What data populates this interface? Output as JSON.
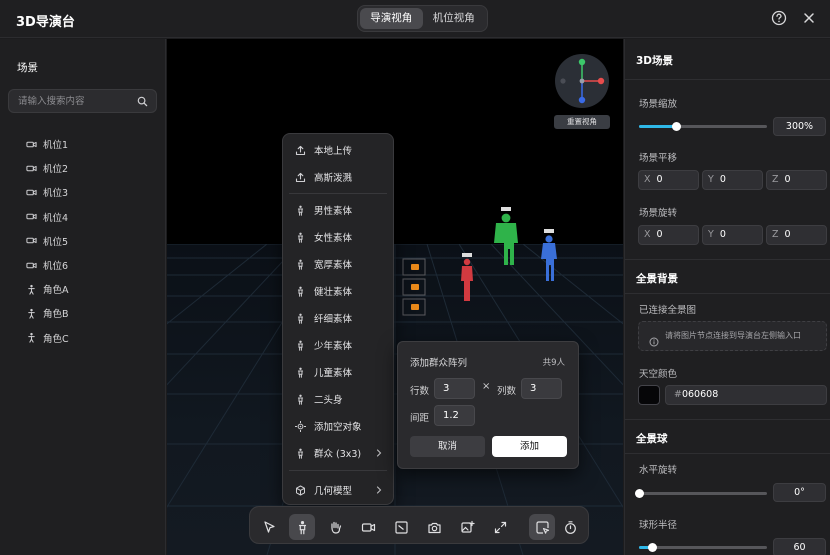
{
  "app": {
    "title": "3D导演台"
  },
  "view_toggle": {
    "director": "导演视角",
    "camera": "机位视角",
    "active": "director"
  },
  "left_panel": {
    "title": "场景",
    "search_placeholder": "请输入搜索内容",
    "items": [
      {
        "label": "机位1",
        "icon": "camera-icon"
      },
      {
        "label": "机位2",
        "icon": "camera-icon"
      },
      {
        "label": "机位3",
        "icon": "camera-icon"
      },
      {
        "label": "机位4",
        "icon": "camera-icon"
      },
      {
        "label": "机位5",
        "icon": "camera-icon"
      },
      {
        "label": "机位6",
        "icon": "camera-icon"
      },
      {
        "label": "角色A",
        "icon": "person-icon"
      },
      {
        "label": "角色B",
        "icon": "person-icon"
      },
      {
        "label": "角色C",
        "icon": "person-icon"
      }
    ]
  },
  "viewport": {
    "reset_view": "重置视角",
    "gizmo_colors": {
      "x": "#e84c4c",
      "y": "#3a6be8",
      "z": "#3cc86a"
    }
  },
  "context_menu": {
    "upload_local": "本地上传",
    "gaussian": "高斯泼溅",
    "male": "男性素体",
    "female": "女性素体",
    "broad": "宽厚素体",
    "athletic": "健壮素体",
    "slim": "纤细素体",
    "teen": "少年素体",
    "child": "儿童素体",
    "chibi": "二头身",
    "empty_object": "添加空对象",
    "crowd": "群众 (3x3)",
    "geometry": "几何模型"
  },
  "crowd_dialog": {
    "title": "添加群众阵列",
    "count": "共9人",
    "rows_label": "行数",
    "rows": "3",
    "cols_label": "列数",
    "cols": "3",
    "times": "×",
    "spacing_label": "间距",
    "spacing": "1.2",
    "cancel": "取消",
    "add": "添加"
  },
  "right_panel": {
    "title": "3D场景",
    "scale": {
      "label": "场景缩放",
      "value": "300%",
      "fraction": 0.29
    },
    "translate": {
      "label": "场景平移",
      "x": "0",
      "y": "0",
      "z": "0"
    },
    "rotate": {
      "label": "场景旋转",
      "x": "0",
      "y": "0",
      "z": "0"
    },
    "panorama": {
      "title": "全景背景",
      "connected_label": "已连接全景图",
      "connect_hint": "请将图片节点连接到导演台左侧输入口"
    },
    "sky": {
      "label": "天空颜色",
      "value": "060608",
      "color": "#060608"
    },
    "sphere": {
      "title": "全景球",
      "h_rotate_label": "水平旋转",
      "h_rotate_value": "0°",
      "h_rotate_fraction": 0.0,
      "radius_label": "球形半径",
      "radius_value": "60",
      "radius_fraction": 0.1
    }
  },
  "accent_color": "#2fb8e8"
}
